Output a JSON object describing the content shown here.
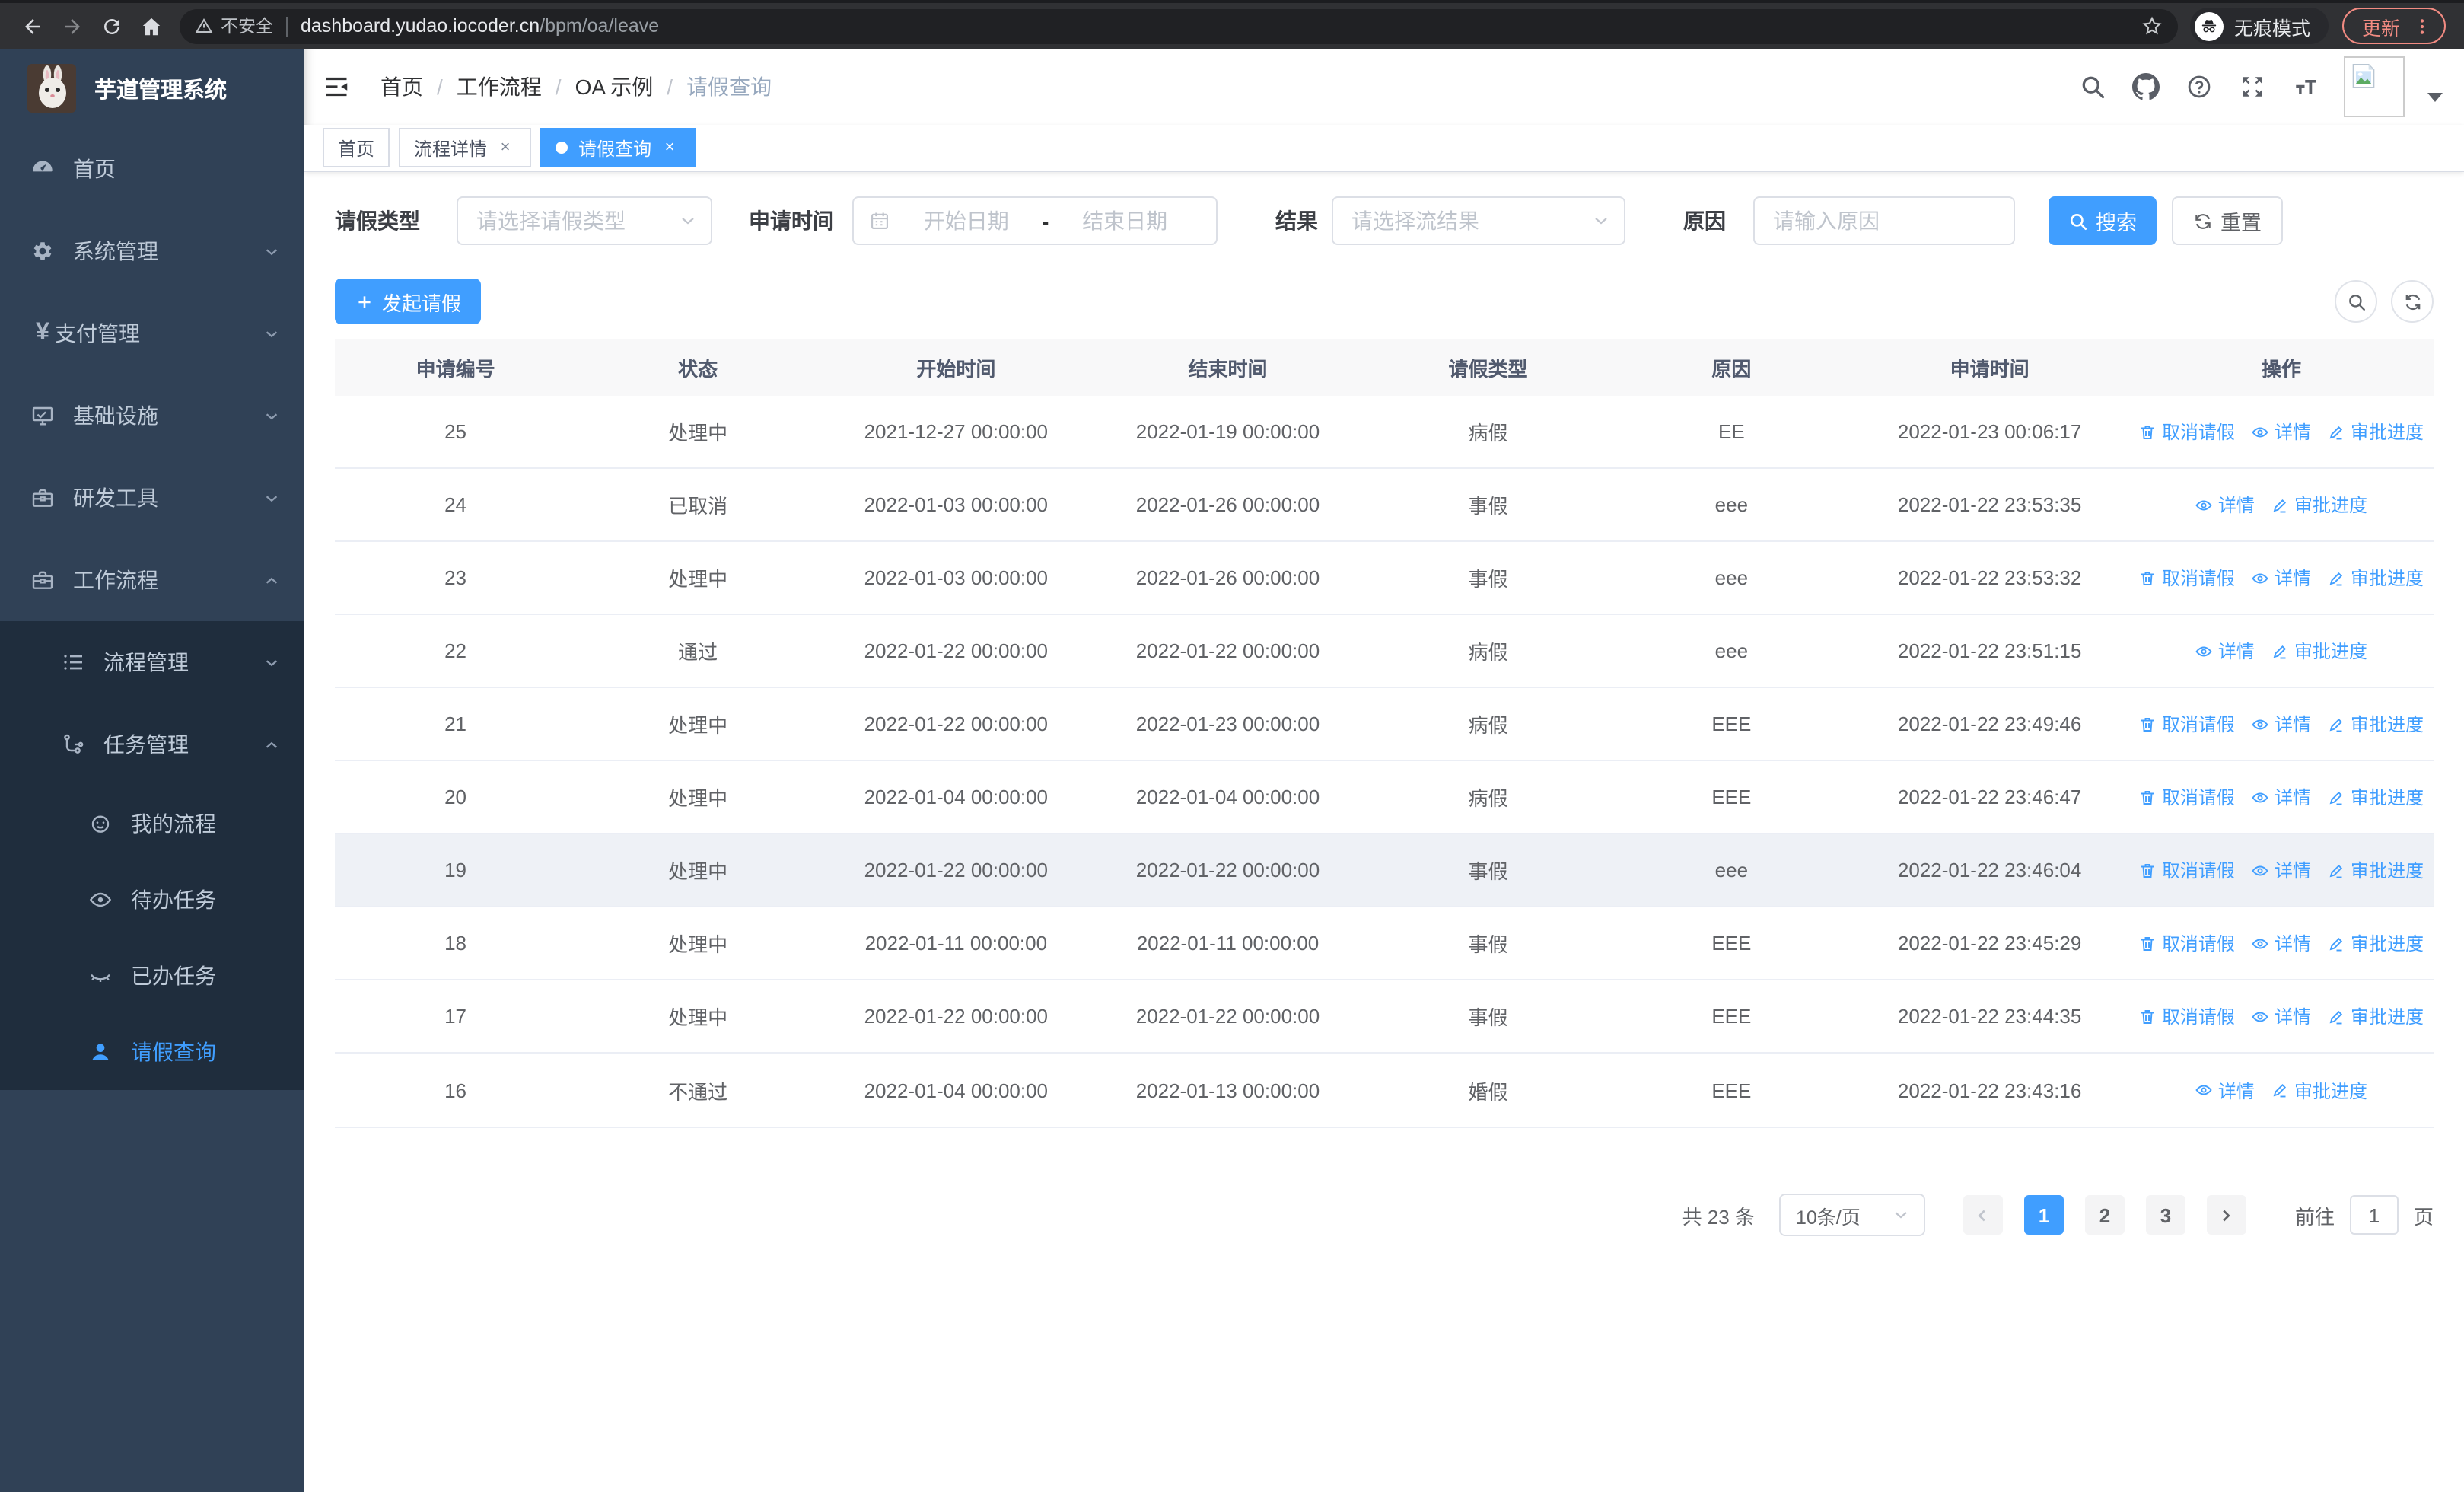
{
  "browser": {
    "security_label": "不安全",
    "url_host": "dashboard.yudao.iocoder.cn",
    "url_path": "/bpm/oa/leave",
    "incognito_label": "无痕模式",
    "update_label": "更新"
  },
  "sidebar": {
    "app_title": "芋道管理系统",
    "items": [
      {
        "label": "首页",
        "icon": "dashboard-icon"
      },
      {
        "label": "系统管理",
        "icon": "gear-icon"
      },
      {
        "label": "支付管理",
        "icon": "yen-icon"
      },
      {
        "label": "基础设施",
        "icon": "monitor-icon"
      },
      {
        "label": "研发工具",
        "icon": "toolbox-icon"
      },
      {
        "label": "工作流程",
        "icon": "briefcase-icon"
      }
    ],
    "submenu": [
      {
        "label": "流程管理",
        "icon": "list-icon"
      },
      {
        "label": "任务管理",
        "icon": "flow-icon"
      }
    ],
    "task_items": [
      {
        "label": "我的流程",
        "icon": "face-icon"
      },
      {
        "label": "待办任务",
        "icon": "eye-icon"
      },
      {
        "label": "已办任务",
        "icon": "eye-closed-icon"
      },
      {
        "label": "请假查询",
        "icon": "user-icon"
      }
    ]
  },
  "header": {
    "breadcrumb": [
      "首页",
      "工作流程",
      "OA 示例",
      "请假查询"
    ],
    "breadcrumb_separator": "/"
  },
  "tabs": [
    {
      "label": "首页",
      "closable": false,
      "active": false
    },
    {
      "label": "流程详情",
      "closable": true,
      "active": false
    },
    {
      "label": "请假查询",
      "closable": true,
      "active": true
    }
  ],
  "filters": {
    "leave_type_label": "请假类型",
    "leave_type_placeholder": "请选择请假类型",
    "apply_time_label": "申请时间",
    "date_start_placeholder": "开始日期",
    "date_separator": "-",
    "date_end_placeholder": "结束日期",
    "result_label": "结果",
    "result_placeholder": "请选择流结果",
    "reason_label": "原因",
    "reason_placeholder": "请输入原因",
    "search_label": "搜索",
    "reset_label": "重置"
  },
  "toolbar": {
    "create_label": "发起请假"
  },
  "table": {
    "columns": [
      "申请编号",
      "状态",
      "开始时间",
      "结束时间",
      "请假类型",
      "原因",
      "申请时间",
      "操作"
    ],
    "action_labels": {
      "cancel": "取消请假",
      "detail": "详情",
      "progress": "审批进度"
    },
    "rows": [
      {
        "id": "25",
        "status": "处理中",
        "start": "2021-12-27 00:00:00",
        "end": "2022-01-19 00:00:00",
        "type": "病假",
        "reason": "EE",
        "apply": "2022-01-23 00:06:17",
        "actions": [
          "cancel",
          "detail",
          "progress"
        ],
        "highlight": false
      },
      {
        "id": "24",
        "status": "已取消",
        "start": "2022-01-03 00:00:00",
        "end": "2022-01-26 00:00:00",
        "type": "事假",
        "reason": "eee",
        "apply": "2022-01-22 23:53:35",
        "actions": [
          "detail",
          "progress"
        ],
        "highlight": false
      },
      {
        "id": "23",
        "status": "处理中",
        "start": "2022-01-03 00:00:00",
        "end": "2022-01-26 00:00:00",
        "type": "事假",
        "reason": "eee",
        "apply": "2022-01-22 23:53:32",
        "actions": [
          "cancel",
          "detail",
          "progress"
        ],
        "highlight": false
      },
      {
        "id": "22",
        "status": "通过",
        "start": "2022-01-22 00:00:00",
        "end": "2022-01-22 00:00:00",
        "type": "病假",
        "reason": "eee",
        "apply": "2022-01-22 23:51:15",
        "actions": [
          "detail",
          "progress"
        ],
        "highlight": false
      },
      {
        "id": "21",
        "status": "处理中",
        "start": "2022-01-22 00:00:00",
        "end": "2022-01-23 00:00:00",
        "type": "病假",
        "reason": "EEE",
        "apply": "2022-01-22 23:49:46",
        "actions": [
          "cancel",
          "detail",
          "progress"
        ],
        "highlight": false
      },
      {
        "id": "20",
        "status": "处理中",
        "start": "2022-01-04 00:00:00",
        "end": "2022-01-04 00:00:00",
        "type": "病假",
        "reason": "EEE",
        "apply": "2022-01-22 23:46:47",
        "actions": [
          "cancel",
          "detail",
          "progress"
        ],
        "highlight": false
      },
      {
        "id": "19",
        "status": "处理中",
        "start": "2022-01-22 00:00:00",
        "end": "2022-01-22 00:00:00",
        "type": "事假",
        "reason": "eee",
        "apply": "2022-01-22 23:46:04",
        "actions": [
          "cancel",
          "detail",
          "progress"
        ],
        "highlight": true
      },
      {
        "id": "18",
        "status": "处理中",
        "start": "2022-01-11 00:00:00",
        "end": "2022-01-11 00:00:00",
        "type": "事假",
        "reason": "EEE",
        "apply": "2022-01-22 23:45:29",
        "actions": [
          "cancel",
          "detail",
          "progress"
        ],
        "highlight": false
      },
      {
        "id": "17",
        "status": "处理中",
        "start": "2022-01-22 00:00:00",
        "end": "2022-01-22 00:00:00",
        "type": "事假",
        "reason": "EEE",
        "apply": "2022-01-22 23:44:35",
        "actions": [
          "cancel",
          "detail",
          "progress"
        ],
        "highlight": false
      },
      {
        "id": "16",
        "status": "不通过",
        "start": "2022-01-04 00:00:00",
        "end": "2022-01-13 00:00:00",
        "type": "婚假",
        "reason": "EEE",
        "apply": "2022-01-22 23:43:16",
        "actions": [
          "detail",
          "progress"
        ],
        "highlight": false
      }
    ]
  },
  "pagination": {
    "total_label": "共 23 条",
    "page_size": "10条/页",
    "pages": [
      "1",
      "2",
      "3"
    ],
    "active_page": "1",
    "goto_label": "前往",
    "goto_value": "1",
    "page_suffix": "页"
  },
  "colors": {
    "accent": "#409eff",
    "sidebar_bg": "#304156",
    "submenu_bg": "#1f2d3d",
    "update_badge": "#f28b82"
  }
}
